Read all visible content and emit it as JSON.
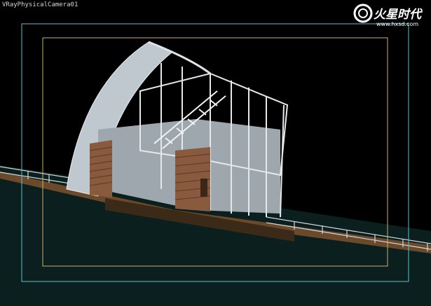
{
  "viewport": {
    "label": "VRayPhysicalCamera01",
    "background": "#000000",
    "safe_frame_color": "#5fc1c8",
    "render_region_color": "#c9b26a"
  },
  "watermark": {
    "logo_text": "火星时代",
    "url_text": "www.hxsd.com",
    "icon": "fire-ring-logo"
  },
  "scene": {
    "subject": "wireframe-shaded-building",
    "ground_color": "#0d2222",
    "deck_color": "#6a4a2c",
    "frame_color": "#d8dde2",
    "wood_color": "#8a5a3e"
  }
}
